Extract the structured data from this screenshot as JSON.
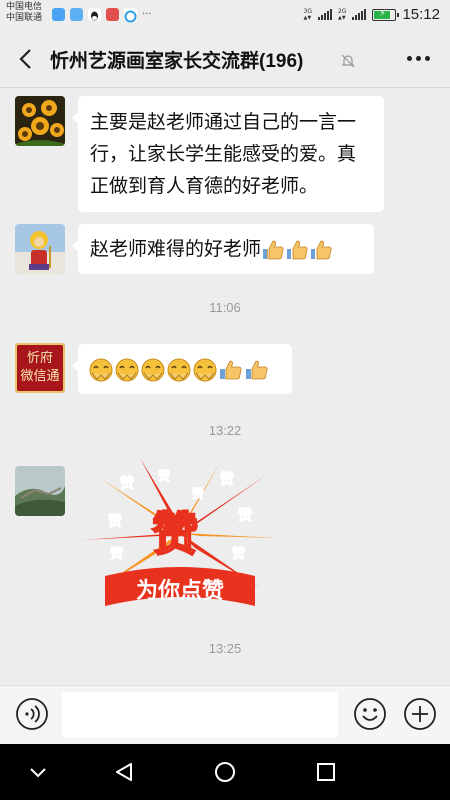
{
  "status_bar": {
    "carrier_1": "中国电信",
    "carrier_2": "中国联通",
    "network_1": "3G",
    "network_2": "2G",
    "time": "15:12",
    "battery_level": 0.7,
    "app_icons": [
      "message-app-icon",
      "chat-app-icon",
      "qq-icon",
      "weibo-icon",
      "browser-icon"
    ],
    "more": "···"
  },
  "header": {
    "title": "忻州艺源画室家长交流群(196)",
    "icons": [
      "back-arrow-icon",
      "mute-bell-icon",
      "more-icon"
    ]
  },
  "messages": [
    {
      "type": "text",
      "avatar": "sunflower-avatar",
      "text": "主要是赵老师通过自己的一言一行，让家长学生能感受的爱。真正做到育人育德的好老师。"
    },
    {
      "type": "text-emoji",
      "avatar": "monkey-king-avatar",
      "text": "赵老师难得的好老师",
      "emojis": [
        "thumbs-up",
        "thumbs-up",
        "thumbs-up"
      ]
    },
    {
      "type": "timestamp",
      "text": "11:06"
    },
    {
      "type": "emoji-only",
      "avatar": "weixintong-avatar",
      "avatar_text_1": "忻府",
      "avatar_text_2": "微信通",
      "emojis": [
        "applause",
        "applause",
        "applause",
        "applause",
        "applause",
        "thumbs-up",
        "thumbs-up"
      ]
    },
    {
      "type": "timestamp",
      "text": "13:22"
    },
    {
      "type": "sticker",
      "avatar": "great-wall-avatar",
      "sticker_main": "赞",
      "sticker_caption": "为你点赞",
      "sticker_small": "赞"
    },
    {
      "type": "timestamp",
      "text": "13:25"
    }
  ],
  "input_bar": {
    "value": "",
    "icons": [
      "voice-icon",
      "emoji-icon",
      "plus-icon"
    ]
  },
  "nav_bar": {
    "icons": [
      "hide-keyboard-icon",
      "back-icon",
      "home-icon",
      "recents-icon"
    ]
  },
  "colors": {
    "background": "#ededed",
    "bubble": "#ffffff",
    "sticker_red": "#e8321e",
    "sticker_orange": "#f7931e"
  }
}
